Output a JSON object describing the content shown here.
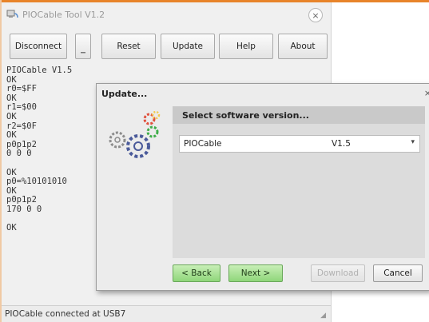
{
  "main_window": {
    "title": "PIOCable Tool V1.2",
    "close_glyph": "×",
    "toolbar": {
      "disconnect_label": "Disconnect",
      "reset_label": "Reset",
      "update_label": "Update",
      "help_label": "Help",
      "about_label": "About"
    },
    "console_lines": [
      "PIOCable V1.5",
      "OK",
      "r0=$FF",
      "OK",
      "r1=$00",
      "OK",
      "r2=$0F",
      "OK",
      "p0p1p2",
      "0 0 0",
      "",
      "OK",
      "p0=%10101010",
      "OK",
      "p0p1p2",
      "170 0 0",
      "",
      "OK"
    ],
    "status_text": "PIOCable connected at USB7"
  },
  "update_dialog": {
    "title": "Update...",
    "close_glyph": "×",
    "heading": "Select software version...",
    "select": {
      "name": "PIOCable",
      "version": "V1.5",
      "arrow": "▾"
    },
    "buttons": {
      "back_label": "< Back",
      "next_label": "Next >",
      "download_label": "Download",
      "cancel_label": "Cancel"
    }
  },
  "icons": {
    "app_icon": "cable-icon",
    "gears": "gears-icon",
    "colors": {
      "gear_red": "#e0503c",
      "gear_green": "#3fae49",
      "gear_yellow": "#f2c94c",
      "gear_gray": "#8c8c8c"
    }
  },
  "colors": {
    "frame_accent": "#e8842a",
    "button_green": "#8fd67a"
  }
}
